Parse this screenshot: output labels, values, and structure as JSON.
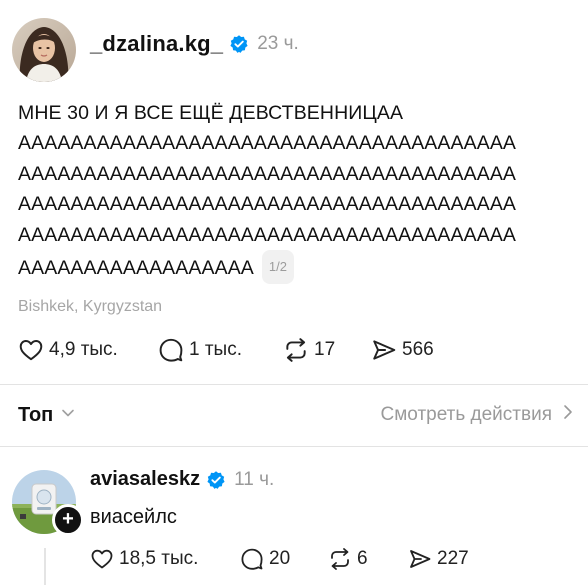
{
  "post": {
    "username": "_dzalina.kg_",
    "time": "23 ч.",
    "text_lines": [
      "МНЕ 30 И Я ВСЕ ЕЩЁ ДЕВСТВЕННИЦАА",
      "АААААААААААААААААААААААААААААААААААААА",
      "АААААААААААААААААААААААААААААААААААААА",
      "АААААААААААААААААААААААААААААААААААААА",
      "АААААААААААААААААААААААААААААААААААААА",
      "АААААААААААААААААА"
    ],
    "page_indicator": "1/2",
    "location": "Bishkek, Kyrgyzstan",
    "likes": "4,9 тыс.",
    "comments": "1 тыс.",
    "reposts": "17",
    "shares": "566"
  },
  "sort": {
    "label": "Топ",
    "see_activity": "Смотреть действия"
  },
  "reply": {
    "username": "aviasaleskz",
    "time": "11 ч.",
    "text": "виасейлс",
    "likes": "18,5 тыс.",
    "comments": "20",
    "reposts": "6",
    "shares": "227"
  },
  "colors": {
    "verified": "#0095f6",
    "text": "#111111",
    "muted": "#9a9a9a"
  },
  "icons": [
    "heart-icon",
    "comment-icon",
    "repost-icon",
    "share-icon",
    "verified-badge-icon",
    "chevron-down-icon",
    "chevron-right-icon",
    "plus-icon"
  ]
}
